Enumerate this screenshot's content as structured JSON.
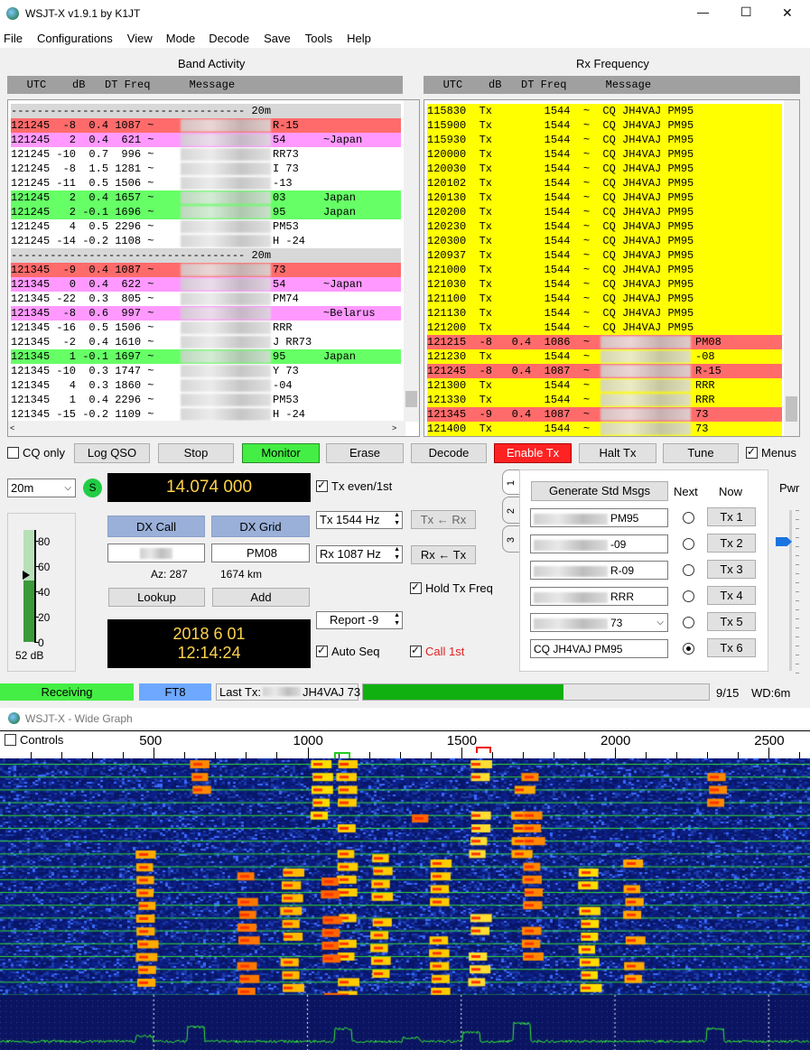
{
  "title_bar": {
    "title": "WSJT-X   v1.9.1   by K1JT",
    "min": "—",
    "max": "☐",
    "close": "✕"
  },
  "menu": [
    "File",
    "Configurations",
    "View",
    "Mode",
    "Decode",
    "Save",
    "Tools",
    "Help"
  ],
  "band_activity": {
    "title": "Band Activity",
    "header": "   UTC    dB   DT Freq      Message",
    "rows": [
      {
        "t": "------------------------------------ 20m",
        "bg": "#d8d8d8",
        "b": false,
        "s": ""
      },
      {
        "t": "121245  -8  0.4 1087 ~ ",
        "bg": "#ff6b6b",
        "b": true,
        "s": "R-15",
        "c": ""
      },
      {
        "t": "121245   2  0.4  621 ~ ",
        "bg": "#ff99ff",
        "b": true,
        "s": "54",
        "c": "~Japan"
      },
      {
        "t": "121245 -10  0.7  996 ~ ",
        "bg": "#ffffff",
        "b": true,
        "s": "RR73",
        "c": ""
      },
      {
        "t": "121245  -8  1.5 1281 ~ ",
        "bg": "#ffffff",
        "b": true,
        "s": "I 73",
        "c": ""
      },
      {
        "t": "121245 -11  0.5 1506 ~ ",
        "bg": "#ffffff",
        "b": true,
        "s": "-13",
        "c": ""
      },
      {
        "t": "121245   2  0.4 1657 ~ ",
        "bg": "#66ff66",
        "b": true,
        "s": "03",
        "c": "Japan"
      },
      {
        "t": "121245   2 -0.1 1696 ~ ",
        "bg": "#66ff66",
        "b": true,
        "s": "95",
        "c": "Japan"
      },
      {
        "t": "121245   4  0.5 2296 ~ ",
        "bg": "#ffffff",
        "b": true,
        "s": "PM53",
        "c": ""
      },
      {
        "t": "121245 -14 -0.2 1108 ~ ",
        "bg": "#ffffff",
        "b": true,
        "s": "H -24",
        "c": ""
      },
      {
        "t": "------------------------------------ 20m",
        "bg": "#d8d8d8",
        "b": false,
        "s": ""
      },
      {
        "t": "121345  -9  0.4 1087 ~ ",
        "bg": "#ff6b6b",
        "b": true,
        "s": "73",
        "c": ""
      },
      {
        "t": "121345   0  0.4  622 ~ ",
        "bg": "#ff99ff",
        "b": true,
        "s": "54",
        "c": "~Japan"
      },
      {
        "t": "121345 -22  0.3  805 ~ ",
        "bg": "#ffffff",
        "b": true,
        "s": "PM74",
        "c": ""
      },
      {
        "t": "121345  -8  0.6  997 ~ ",
        "bg": "#ff99ff",
        "b": true,
        "s": "",
        "c": "~Belarus"
      },
      {
        "t": "121345 -16  0.5 1506 ~ ",
        "bg": "#ffffff",
        "b": true,
        "s": "RRR",
        "c": ""
      },
      {
        "t": "121345  -2  0.4 1610 ~ ",
        "bg": "#ffffff",
        "b": true,
        "s": "J RR73",
        "c": ""
      },
      {
        "t": "121345   1 -0.1 1697 ~ ",
        "bg": "#66ff66",
        "b": true,
        "s": "95",
        "c": "Japan"
      },
      {
        "t": "121345 -10  0.3 1747 ~ ",
        "bg": "#ffffff",
        "b": true,
        "s": "Y 73",
        "c": ""
      },
      {
        "t": "121345   4  0.3 1860 ~ ",
        "bg": "#ffffff",
        "b": true,
        "s": "-04",
        "c": ""
      },
      {
        "t": "121345   1  0.4 2296 ~ ",
        "bg": "#ffffff",
        "b": true,
        "s": "PM53",
        "c": ""
      },
      {
        "t": "121345 -15 -0.2 1109 ~ ",
        "bg": "#ffffff",
        "b": true,
        "s": "H -24",
        "c": ""
      }
    ]
  },
  "rx_frequency": {
    "title": "Rx Frequency",
    "header": "   UTC    dB   DT Freq      Message",
    "rows": [
      {
        "t": "115830  Tx        1544  ~  CQ JH4VAJ PM95",
        "bg": "#ffff00",
        "b": false,
        "s": ""
      },
      {
        "t": "115900  Tx        1544  ~  CQ JH4VAJ PM95",
        "bg": "#ffff00",
        "b": false,
        "s": ""
      },
      {
        "t": "115930  Tx        1544  ~  CQ JH4VAJ PM95",
        "bg": "#ffff00",
        "b": false,
        "s": ""
      },
      {
        "t": "120000  Tx        1544  ~  CQ JH4VAJ PM95",
        "bg": "#ffff00",
        "b": false,
        "s": ""
      },
      {
        "t": "120030  Tx        1544  ~  CQ JH4VAJ PM95",
        "bg": "#ffff00",
        "b": false,
        "s": ""
      },
      {
        "t": "120102  Tx        1544  ~  CQ JH4VAJ PM95",
        "bg": "#ffff00",
        "b": false,
        "s": ""
      },
      {
        "t": "120130  Tx        1544  ~  CQ JH4VAJ PM95",
        "bg": "#ffff00",
        "b": false,
        "s": ""
      },
      {
        "t": "120200  Tx        1544  ~  CQ JH4VAJ PM95",
        "bg": "#ffff00",
        "b": false,
        "s": ""
      },
      {
        "t": "120230  Tx        1544  ~  CQ JH4VAJ PM95",
        "bg": "#ffff00",
        "b": false,
        "s": ""
      },
      {
        "t": "120300  Tx        1544  ~  CQ JH4VAJ PM95",
        "bg": "#ffff00",
        "b": false,
        "s": ""
      },
      {
        "t": "120937  Tx        1544  ~  CQ JH4VAJ PM95",
        "bg": "#ffff00",
        "b": false,
        "s": ""
      },
      {
        "t": "121000  Tx        1544  ~  CQ JH4VAJ PM95",
        "bg": "#ffff00",
        "b": false,
        "s": ""
      },
      {
        "t": "121030  Tx        1544  ~  CQ JH4VAJ PM95",
        "bg": "#ffff00",
        "b": false,
        "s": ""
      },
      {
        "t": "121100  Tx        1544  ~  CQ JH4VAJ PM95",
        "bg": "#ffff00",
        "b": false,
        "s": ""
      },
      {
        "t": "121130  Tx        1544  ~  CQ JH4VAJ PM95",
        "bg": "#ffff00",
        "b": false,
        "s": ""
      },
      {
        "t": "121200  Tx        1544  ~  CQ JH4VAJ PM95",
        "bg": "#ffff00",
        "b": false,
        "s": ""
      },
      {
        "t": "121215  -8   0.4  1086  ~ ",
        "bg": "#ff6b6b",
        "b": true,
        "s": "PM08"
      },
      {
        "t": "121230  Tx        1544  ~ ",
        "bg": "#ffff00",
        "b": true,
        "s": "-08"
      },
      {
        "t": "121245  -8   0.4  1087  ~ ",
        "bg": "#ff6b6b",
        "b": true,
        "s": "R-15"
      },
      {
        "t": "121300  Tx        1544  ~ ",
        "bg": "#ffff00",
        "b": true,
        "s": "RRR"
      },
      {
        "t": "121330  Tx        1544  ~ ",
        "bg": "#ffff00",
        "b": true,
        "s": "RRR"
      },
      {
        "t": "121345  -9   0.4  1087  ~ ",
        "bg": "#ff6b6b",
        "b": true,
        "s": "73"
      },
      {
        "t": "121400  Tx        1544  ~ ",
        "bg": "#ffff00",
        "b": true,
        "s": "73"
      }
    ]
  },
  "buttons": {
    "cq_only": "CQ only",
    "log_qso": "Log QSO",
    "stop": "Stop",
    "monitor": "Monitor",
    "erase": "Erase",
    "decode": "Decode",
    "enable_tx": "Enable Tx",
    "halt_tx": "Halt Tx",
    "tune": "Tune",
    "menus": "Menus"
  },
  "band": "20m",
  "s_label": "S",
  "frequency": "14.074 000",
  "tx_even": "Tx even/1st",
  "dx_call_label": "DX Call",
  "dx_grid_label": "DX Grid",
  "dx_grid_value": "PM08",
  "az": "Az: 287",
  "dist": "1674 km",
  "lookup": "Lookup",
  "add": "Add",
  "tx_hz": "Tx  1544  Hz",
  "rx_hz": "Rx  1087  Hz",
  "tx_from_rx": "Tx ← Rx",
  "rx_from_tx": "Rx ← Tx",
  "hold_tx": "Hold Tx Freq",
  "report": "Report -9",
  "auto_seq": "Auto Seq",
  "call_1st": "Call 1st",
  "date": "2018 6 01",
  "time": "12:14:24",
  "meter": {
    "ticks": [
      "80",
      "60",
      "40",
      "20",
      "0"
    ],
    "db": "52 dB",
    "level": 0.52
  },
  "tabs": [
    "1",
    "2",
    "3"
  ],
  "gen_std": "Generate Std Msgs",
  "next": "Next",
  "now": "Now",
  "tx_msgs": [
    {
      "suffix": "PM95",
      "btn": "Tx 1"
    },
    {
      "suffix": "-09",
      "btn": "Tx 2"
    },
    {
      "suffix": "R-09",
      "btn": "Tx 3"
    },
    {
      "suffix": "RRR",
      "btn": "Tx 4"
    },
    {
      "suffix": "73",
      "btn": "Tx 5"
    },
    {
      "suffix": "CQ JH4VAJ PM95",
      "btn": "Tx 6"
    }
  ],
  "pwr": "Pwr",
  "status": {
    "receiving": "Receiving",
    "mode": "FT8",
    "last_tx_label": "Last Tx:",
    "last_tx_value": "JH4VAJ 73",
    "progress": 0.58,
    "count": "9/15",
    "wd": "WD:6m"
  },
  "wide_graph": {
    "title": "WSJT-X - Wide Graph",
    "controls": "Controls",
    "ticks": [
      "500",
      "1000",
      "1500",
      "2000",
      "2500"
    ]
  }
}
